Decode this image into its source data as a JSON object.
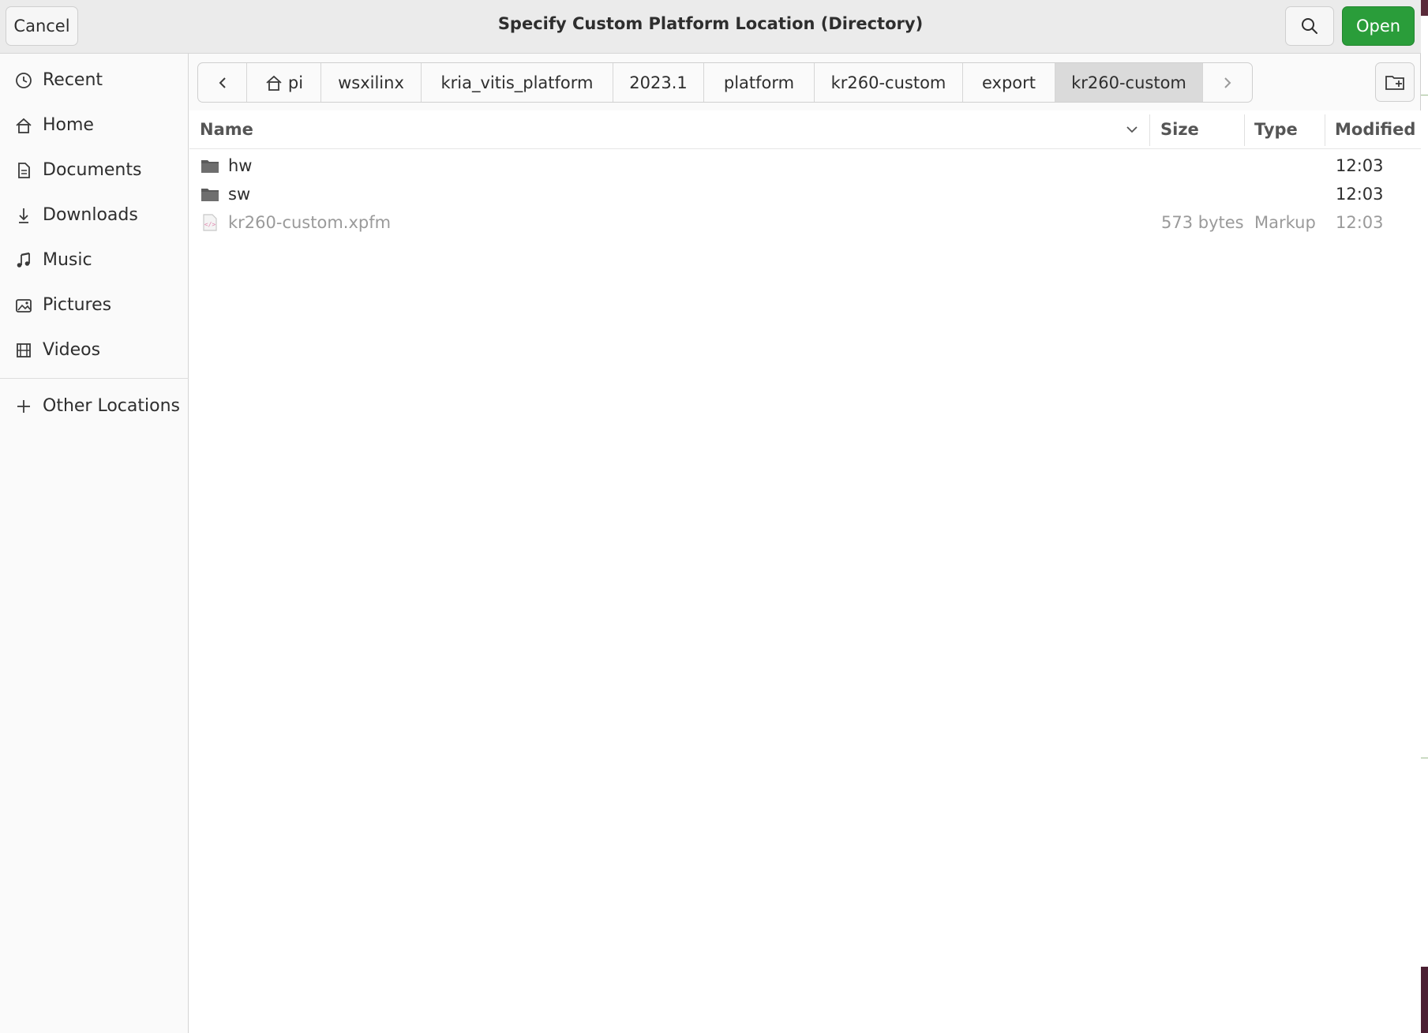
{
  "dialog": {
    "title": "Specify Custom Platform Location (Directory)",
    "cancel_label": "Cancel",
    "open_label": "Open"
  },
  "sidebar": {
    "items": [
      {
        "label": "Recent",
        "icon": "clock-icon"
      },
      {
        "label": "Home",
        "icon": "home-icon"
      },
      {
        "label": "Documents",
        "icon": "document-icon"
      },
      {
        "label": "Downloads",
        "icon": "download-icon"
      },
      {
        "label": "Music",
        "icon": "music-note-icon"
      },
      {
        "label": "Pictures",
        "icon": "image-icon"
      },
      {
        "label": "Videos",
        "icon": "film-icon"
      }
    ],
    "other_locations": {
      "label": "Other Locations",
      "icon": "plus-icon"
    }
  },
  "pathbar": {
    "crumbs": [
      "pi",
      "wsxilinx",
      "kria_vitis_platform",
      "2023.1",
      "platform",
      "kr260-custom",
      "export",
      "kr260-custom"
    ],
    "active_index": 7
  },
  "file_list": {
    "columns": {
      "name": "Name",
      "size": "Size",
      "type": "Type",
      "modified": "Modified"
    },
    "rows": [
      {
        "name": "hw",
        "size": "",
        "type": "",
        "modified": "12:03",
        "kind": "folder"
      },
      {
        "name": "sw",
        "size": "",
        "type": "",
        "modified": "12:03",
        "kind": "folder"
      },
      {
        "name": "kr260-custom.xpfm",
        "size": "573 bytes",
        "type": "Markup",
        "modified": "12:03",
        "kind": "file"
      }
    ]
  },
  "colors": {
    "accent_open": "#2a9d3a",
    "active_crumb": "#dadada"
  }
}
